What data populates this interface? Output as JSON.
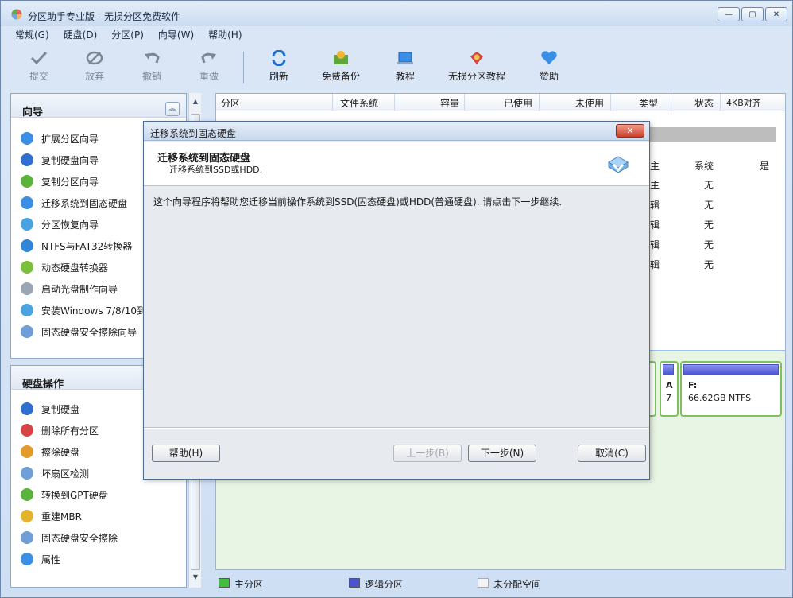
{
  "window": {
    "title": "分区助手专业版 - 无损分区免费软件",
    "minimize": "—",
    "maximize": "▢",
    "close": "✕"
  },
  "menu": [
    "常规(G)",
    "硬盘(D)",
    "分区(P)",
    "向导(W)",
    "帮助(H)"
  ],
  "toolbar": [
    {
      "label": "提交",
      "icon": "check-icon",
      "enabled": false
    },
    {
      "label": "放弃",
      "icon": "discard-icon",
      "enabled": false
    },
    {
      "label": "撤销",
      "icon": "undo-icon",
      "enabled": false
    },
    {
      "label": "重做",
      "icon": "redo-icon",
      "enabled": false
    },
    {
      "label": "刷新",
      "icon": "refresh-icon",
      "enabled": true
    },
    {
      "label": "免费备份",
      "icon": "backup-icon",
      "enabled": true
    },
    {
      "label": "教程",
      "icon": "tutorial-icon",
      "enabled": true
    },
    {
      "label": "无损分区教程",
      "icon": "lossless-tutorial-icon",
      "enabled": true
    },
    {
      "label": "赞助",
      "icon": "heart-icon",
      "enabled": true
    }
  ],
  "wizard_panel": {
    "title": "向导",
    "items": [
      "扩展分区向导",
      "复制硬盘向导",
      "复制分区向导",
      "迁移系统到固态硬盘",
      "分区恢复向导",
      "NTFS与FAT32转换器",
      "动态硬盘转换器",
      "启动光盘制作向导",
      "安装Windows 7/8/10到",
      "固态硬盘安全擦除向导"
    ]
  },
  "disk_panel": {
    "title": "硬盘操作",
    "items": [
      "复制硬盘",
      "删除所有分区",
      "擦除硬盘",
      "坏扇区检测",
      "转换到GPT硬盘",
      "重建MBR",
      "固态硬盘安全擦除",
      "属性"
    ]
  },
  "columns": [
    "分区",
    "文件系统",
    "容量",
    "已使用",
    "未使用",
    "类型",
    "状态",
    "4KB对齐"
  ],
  "rows": [
    {
      "type": "主",
      "status": "系统",
      "align": "是"
    },
    {
      "type": "主",
      "status": "无",
      "align": ""
    },
    {
      "type": "辑",
      "status": "无",
      "align": ""
    },
    {
      "type": "辑",
      "status": "无",
      "align": ""
    },
    {
      "type": "辑",
      "status": "无",
      "align": ""
    },
    {
      "type": "辑",
      "status": "无",
      "align": ""
    }
  ],
  "disk_map": {
    "partial_a": "A",
    "partial_7": "7",
    "drive": "F:",
    "drive_info": "66.62GB NTFS"
  },
  "legend": [
    "主分区",
    "逻辑分区",
    "未分配空间"
  ],
  "dialog": {
    "title": "迁移系统到固态硬盘",
    "close": "✕",
    "header_title": "迁移系统到固态硬盘",
    "header_sub": "迁移系统到SSD或HDD.",
    "body": "这个向导程序将帮助您迁移当前操作系统到SSD(固态硬盘)或HDD(普通硬盘). 请点击下一步继续.",
    "help": "帮助(H)",
    "back": "上一步(B)",
    "next": "下一步(N)",
    "cancel": "取消(C)"
  },
  "colors": {
    "primary_partition": "#3fbf3a",
    "logical_partition": "#4b54cf",
    "unallocated": "#f4f4f4"
  }
}
